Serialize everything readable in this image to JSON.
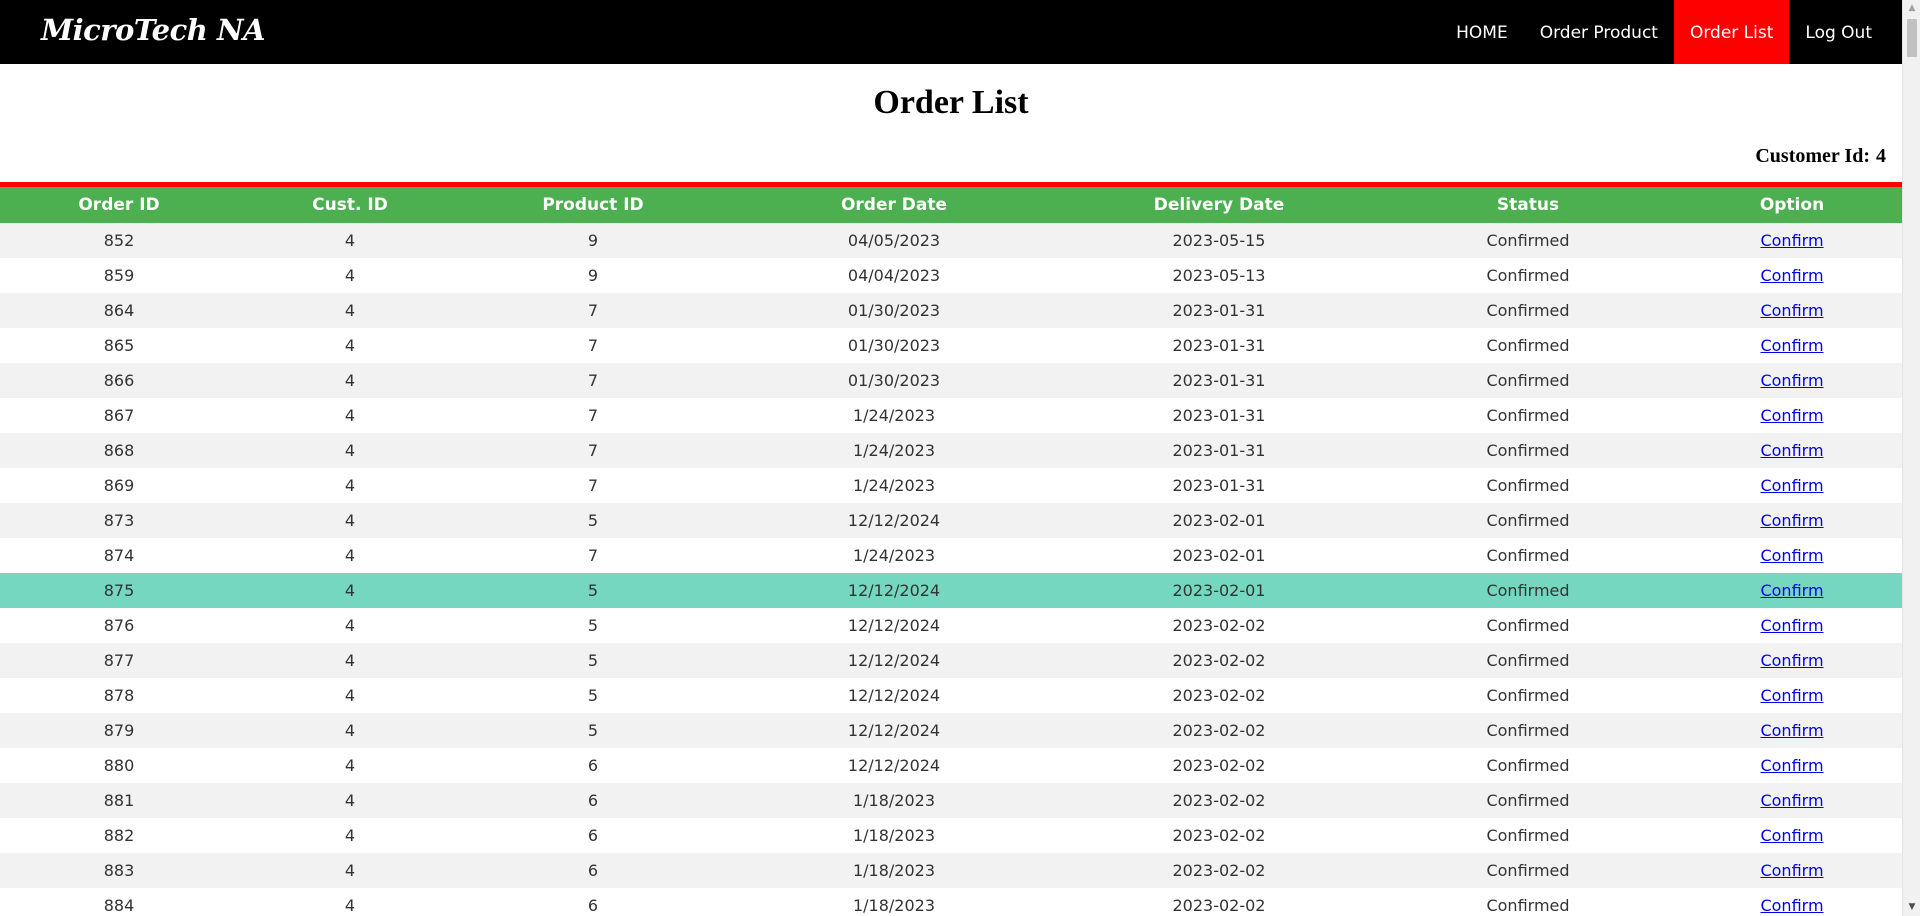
{
  "brand": {
    "logo": "MicroTech NA"
  },
  "nav": {
    "items": [
      {
        "label": "HOME"
      },
      {
        "label": "Order Product"
      },
      {
        "label": "Order List"
      },
      {
        "label": "Log Out"
      }
    ],
    "active_index": 2,
    "active_color": "#ff0000"
  },
  "page": {
    "title": "Order List",
    "customer_label": "Customer Id:",
    "customer_id": "4"
  },
  "colors": {
    "navbar": "#000000",
    "header_row": "#4caf50",
    "divider": "#ff0000",
    "row_highlight": "#76d7c0",
    "row_striped": "#f2f2f2"
  },
  "table": {
    "columns": [
      "Order ID",
      "Cust. ID",
      "Product ID",
      "Order Date",
      "Delivery Date",
      "Status",
      "Option"
    ],
    "highlight_row": 10,
    "rows": [
      {
        "order_id": "852",
        "cust_id": "4",
        "product_id": "9",
        "order_date": "04/05/2023",
        "delivery_date": "2023-05-15",
        "status": "Confirmed",
        "option": "Confirm"
      },
      {
        "order_id": "859",
        "cust_id": "4",
        "product_id": "9",
        "order_date": "04/04/2023",
        "delivery_date": "2023-05-13",
        "status": "Confirmed",
        "option": "Confirm"
      },
      {
        "order_id": "864",
        "cust_id": "4",
        "product_id": "7",
        "order_date": "01/30/2023",
        "delivery_date": "2023-01-31",
        "status": "Confirmed",
        "option": "Confirm"
      },
      {
        "order_id": "865",
        "cust_id": "4",
        "product_id": "7",
        "order_date": "01/30/2023",
        "delivery_date": "2023-01-31",
        "status": "Confirmed",
        "option": "Confirm"
      },
      {
        "order_id": "866",
        "cust_id": "4",
        "product_id": "7",
        "order_date": "01/30/2023",
        "delivery_date": "2023-01-31",
        "status": "Confirmed",
        "option": "Confirm"
      },
      {
        "order_id": "867",
        "cust_id": "4",
        "product_id": "7",
        "order_date": "1/24/2023",
        "delivery_date": "2023-01-31",
        "status": "Confirmed",
        "option": "Confirm"
      },
      {
        "order_id": "868",
        "cust_id": "4",
        "product_id": "7",
        "order_date": "1/24/2023",
        "delivery_date": "2023-01-31",
        "status": "Confirmed",
        "option": "Confirm"
      },
      {
        "order_id": "869",
        "cust_id": "4",
        "product_id": "7",
        "order_date": "1/24/2023",
        "delivery_date": "2023-01-31",
        "status": "Confirmed",
        "option": "Confirm"
      },
      {
        "order_id": "873",
        "cust_id": "4",
        "product_id": "5",
        "order_date": "12/12/2024",
        "delivery_date": "2023-02-01",
        "status": "Confirmed",
        "option": "Confirm"
      },
      {
        "order_id": "874",
        "cust_id": "4",
        "product_id": "7",
        "order_date": "1/24/2023",
        "delivery_date": "2023-02-01",
        "status": "Confirmed",
        "option": "Confirm"
      },
      {
        "order_id": "875",
        "cust_id": "4",
        "product_id": "5",
        "order_date": "12/12/2024",
        "delivery_date": "2023-02-01",
        "status": "Confirmed",
        "option": "Confirm"
      },
      {
        "order_id": "876",
        "cust_id": "4",
        "product_id": "5",
        "order_date": "12/12/2024",
        "delivery_date": "2023-02-02",
        "status": "Confirmed",
        "option": "Confirm"
      },
      {
        "order_id": "877",
        "cust_id": "4",
        "product_id": "5",
        "order_date": "12/12/2024",
        "delivery_date": "2023-02-02",
        "status": "Confirmed",
        "option": "Confirm"
      },
      {
        "order_id": "878",
        "cust_id": "4",
        "product_id": "5",
        "order_date": "12/12/2024",
        "delivery_date": "2023-02-02",
        "status": "Confirmed",
        "option": "Confirm"
      },
      {
        "order_id": "879",
        "cust_id": "4",
        "product_id": "5",
        "order_date": "12/12/2024",
        "delivery_date": "2023-02-02",
        "status": "Confirmed",
        "option": "Confirm"
      },
      {
        "order_id": "880",
        "cust_id": "4",
        "product_id": "6",
        "order_date": "12/12/2024",
        "delivery_date": "2023-02-02",
        "status": "Confirmed",
        "option": "Confirm"
      },
      {
        "order_id": "881",
        "cust_id": "4",
        "product_id": "6",
        "order_date": "1/18/2023",
        "delivery_date": "2023-02-02",
        "status": "Confirmed",
        "option": "Confirm"
      },
      {
        "order_id": "882",
        "cust_id": "4",
        "product_id": "6",
        "order_date": "1/18/2023",
        "delivery_date": "2023-02-02",
        "status": "Confirmed",
        "option": "Confirm"
      },
      {
        "order_id": "883",
        "cust_id": "4",
        "product_id": "6",
        "order_date": "1/18/2023",
        "delivery_date": "2023-02-02",
        "status": "Confirmed",
        "option": "Confirm"
      },
      {
        "order_id": "884",
        "cust_id": "4",
        "product_id": "6",
        "order_date": "1/18/2023",
        "delivery_date": "2023-02-02",
        "status": "Confirmed",
        "option": "Confirm"
      }
    ]
  }
}
